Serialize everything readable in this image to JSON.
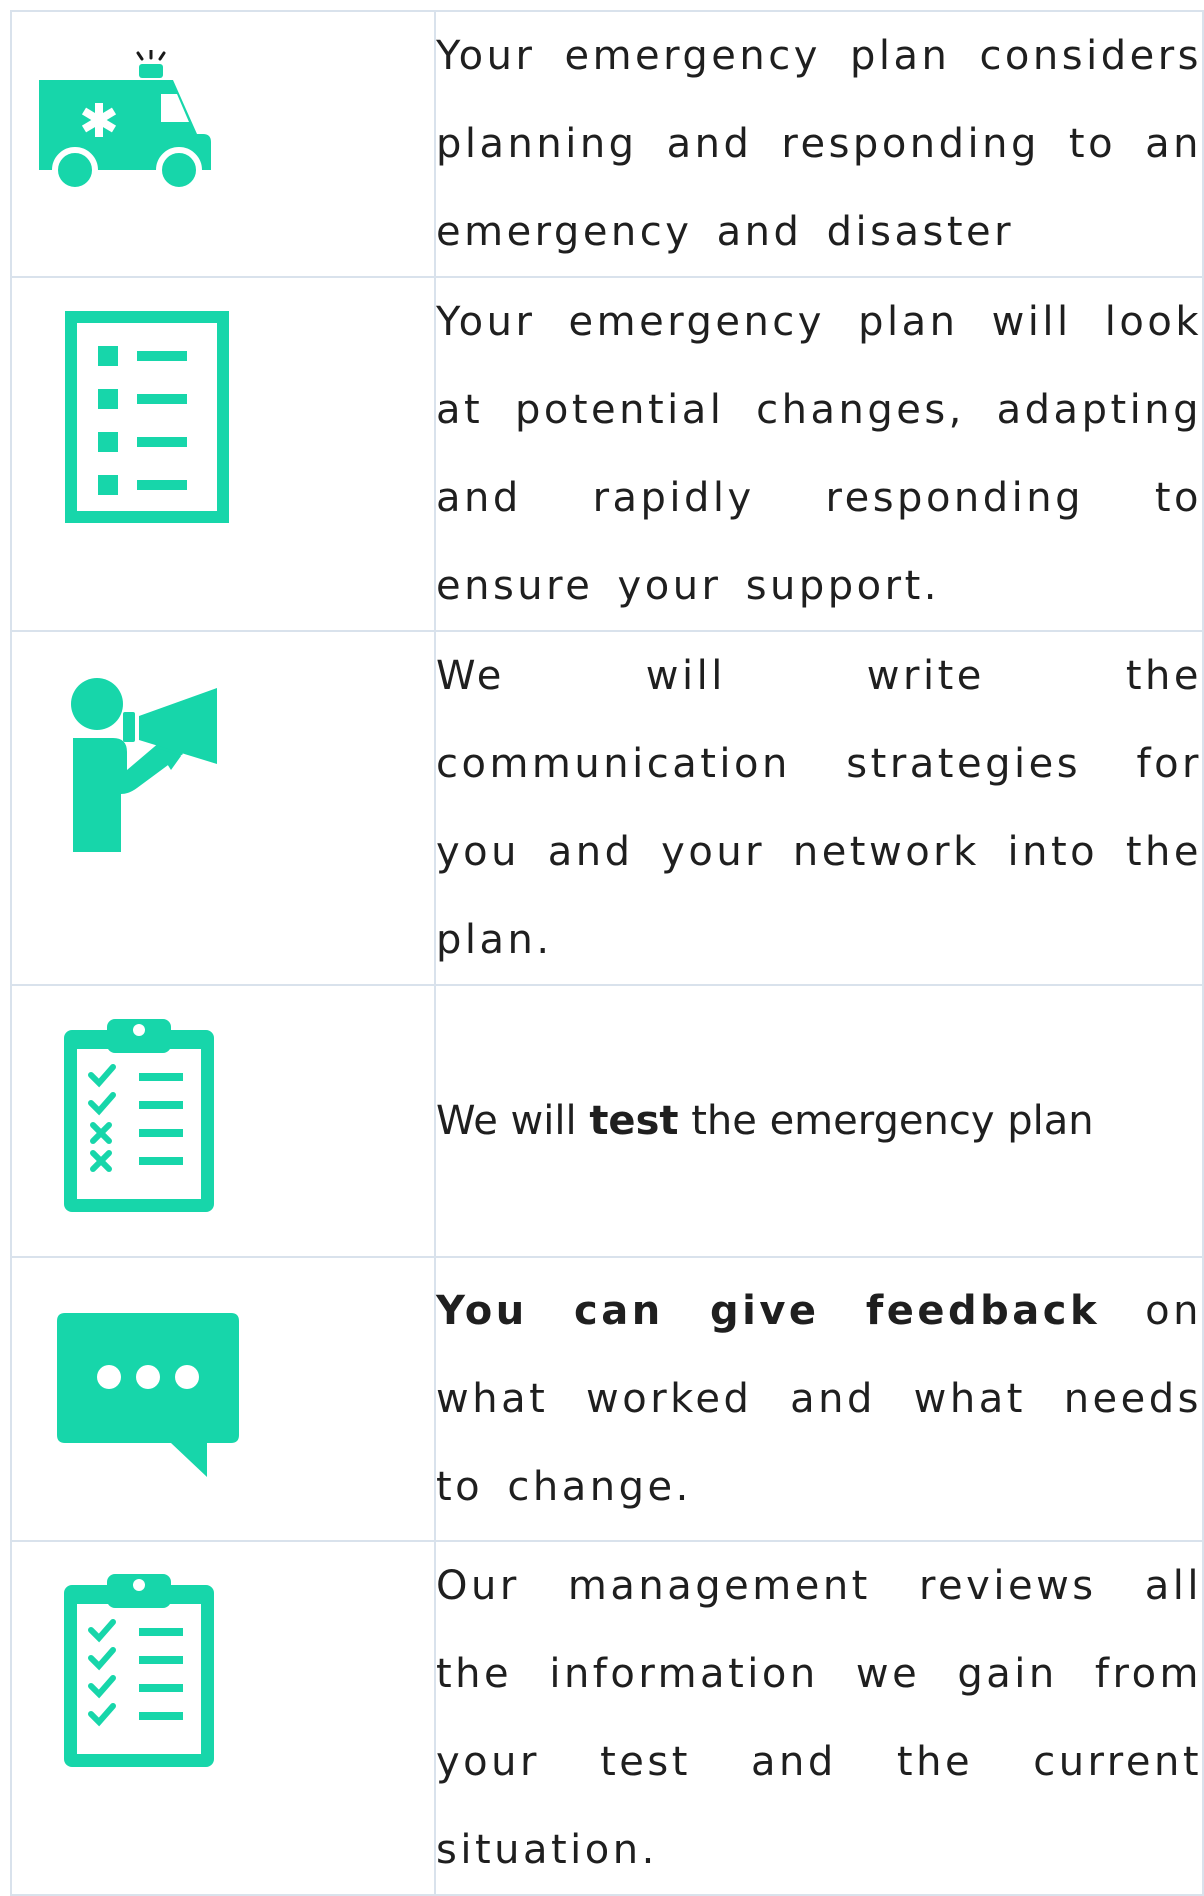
{
  "rows": [
    {
      "icon": "ambulance-icon",
      "text": "Your emergency plan considers planning and responding to an emergency and disaster"
    },
    {
      "icon": "checklist-document-icon",
      "text": "Your emergency plan will look at potential changes, adapting and rapidly responding to ensure your support."
    },
    {
      "icon": "person-megaphone-icon",
      "text": "We will write the communication strategies for you and your network into the plan."
    },
    {
      "icon": "clipboard-test-icon",
      "pre": "We will ",
      "bold": "test",
      "post": " the emergency plan"
    },
    {
      "icon": "speech-bubble-icon",
      "bold": "You can give feedback",
      "post": " on what worked and what needs to change."
    },
    {
      "icon": "clipboard-review-icon",
      "text": "Our management reviews all the information we gain from your test and the current situation."
    }
  ],
  "colors": {
    "accent": "#17d6aa",
    "border": "#d9e2ec",
    "text": "#1f1f1f"
  }
}
